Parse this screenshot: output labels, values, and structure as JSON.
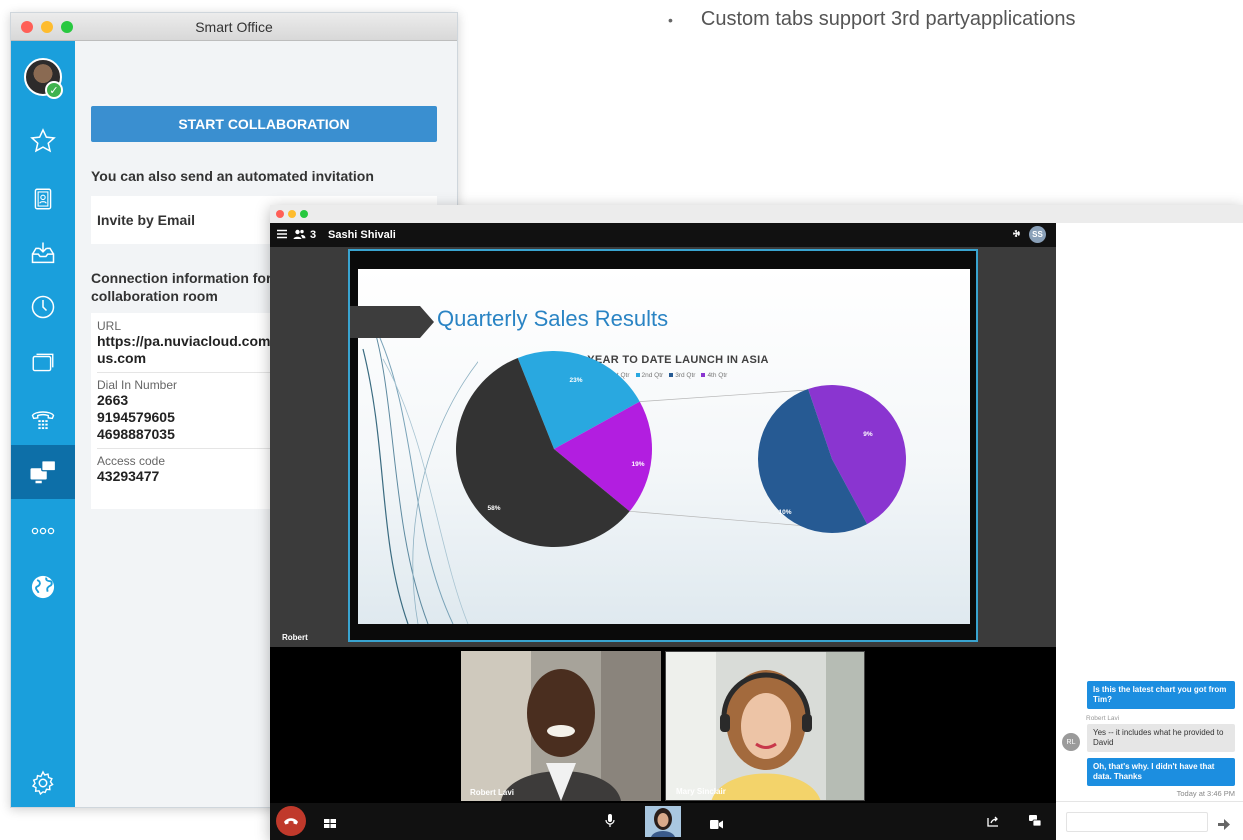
{
  "bullet": {
    "text": "Custom tabs support 3rd partyapplications"
  },
  "smart_office": {
    "window_title": "Smart Office",
    "start_button": "START COLLABORATION",
    "invite_text": "You can also send an automated invitation",
    "invite_email": "Invite by Email",
    "conn_title_1": "Connection information for",
    "conn_title_2": "collaboration room",
    "url_label": "URL",
    "url_line1": "https://pa.nuviacloud.com/",
    "url_line2": "us.com",
    "dial_label": "Dial In Number",
    "dial_values": [
      "2663",
      "9194579605",
      "4698887035"
    ],
    "access_label": "Access code",
    "access_value": "43293477",
    "sidebar_icons": [
      "favorites-star-icon",
      "contacts-icon",
      "inbox-icon",
      "history-clock-icon",
      "screens-icon",
      "phone-dialpad-icon",
      "collaboration-icon",
      "more-icon",
      "globe-icon",
      "settings-gear-icon"
    ]
  },
  "collab": {
    "participant_count": "3",
    "presenter": "Sashi Shivali",
    "presenter_initials": "SS",
    "stage_label": "Robert",
    "slide_title": "Quarterly Sales Results",
    "videos": [
      {
        "name": "Robert Lavi"
      },
      {
        "name": "Mary Sinclair"
      }
    ]
  },
  "chart_data": {
    "type": "pie",
    "title": "YEAR TO DATE LAUNCH IN ASIA",
    "categories": [
      "1st Qtr",
      "2nd Qtr",
      "3rd Qtr",
      "4th Qtr"
    ],
    "values": [
      58,
      23,
      10,
      9
    ],
    "colors": [
      "#333333",
      "#29a8e0",
      "#265a93",
      "#8a35d0"
    ],
    "main_pie_labels": [
      "58%",
      "23%",
      "19%"
    ],
    "secondary_pie_labels": [
      "10%",
      "9%"
    ],
    "legend": "top"
  },
  "chat": {
    "messages": [
      {
        "text": "Is this the latest chart you got from Tim?"
      },
      {
        "sender": "Robert Lavi",
        "initials": "RL",
        "text": "Yes -- it includes what he provided to David"
      },
      {
        "text": "Oh, that's why. I didn't have that data. Thanks"
      }
    ],
    "timestamp": "Today at 3:46 PM"
  }
}
